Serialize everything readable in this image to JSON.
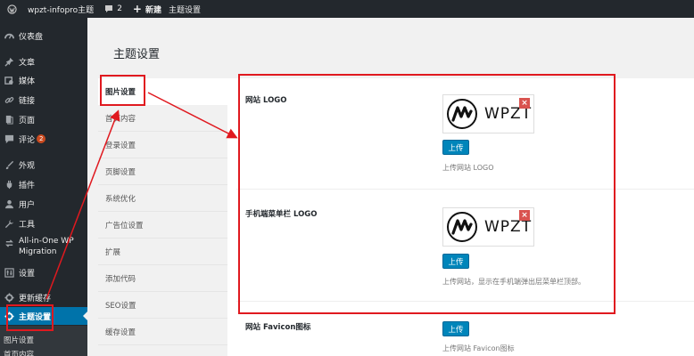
{
  "adminbar": {
    "site_name": "wpzt-infopro主题",
    "comment_count": "2",
    "new_label": "新建",
    "theme_settings_label": "主题设置"
  },
  "sidebar": {
    "items": [
      {
        "label": "仪表盘",
        "icon": "dashboard-icon"
      },
      {
        "label": "文章",
        "icon": "pin-icon"
      },
      {
        "label": "媒体",
        "icon": "media-icon"
      },
      {
        "label": "链接",
        "icon": "link-icon"
      },
      {
        "label": "页面",
        "icon": "page-icon"
      },
      {
        "label": "评论",
        "icon": "comment-icon",
        "badge": "2"
      },
      {
        "label": "外观",
        "icon": "brush-icon"
      },
      {
        "label": "插件",
        "icon": "plugin-icon"
      },
      {
        "label": "用户",
        "icon": "user-icon"
      },
      {
        "label": "工具",
        "icon": "wrench-icon"
      },
      {
        "label": "All-in-One WP Migration",
        "line1": "All-in-One WP",
        "line2": "Migration",
        "icon": "migration-icon"
      },
      {
        "label": "设置",
        "icon": "settings-icon"
      },
      {
        "label": "更新缓存",
        "icon": "gear-icon"
      },
      {
        "label": "主题设置",
        "icon": "gear-icon",
        "active": true
      }
    ],
    "submenu": [
      "图片设置",
      "首页内容"
    ]
  },
  "main": {
    "title": "主题设置",
    "tabs": [
      "图片设置",
      "首页内容",
      "登录设置",
      "页脚设置",
      "系统优化",
      "广告位设置",
      "扩展",
      "添加代码",
      "SEO设置",
      "缓存设置"
    ],
    "active_tab": "图片设置",
    "fields": [
      {
        "label": "网站 LOGO",
        "logo_text": "WPZT",
        "upload_label": "上传",
        "description": "上传网站 LOGO"
      },
      {
        "label": "手机端菜单栏 LOGO",
        "logo_text": "WPZT",
        "upload_label": "上传",
        "description": "上传网站，显示在手机端弹出层菜单栏顶部。"
      },
      {
        "label": "网站 Favicon图标",
        "upload_label": "上传",
        "description": "上传网站 Favicon图标"
      }
    ],
    "delete_symbol": "×"
  },
  "colors": {
    "admin_dark": "#23282d",
    "active_blue": "#0073aa",
    "button_blue": "#0085ba",
    "annotation_red": "#e0191f",
    "badge_orange": "#ca4a1f"
  }
}
